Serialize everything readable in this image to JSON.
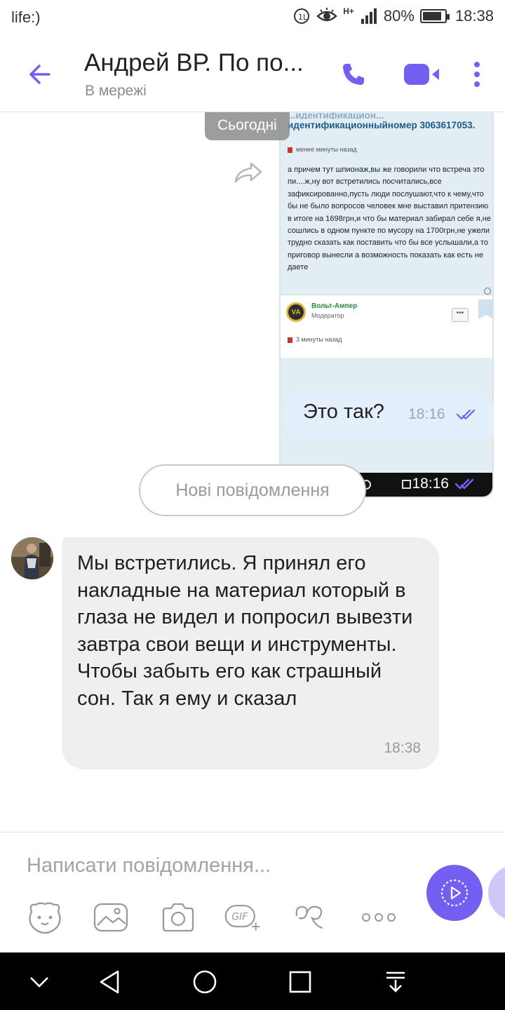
{
  "status_bar": {
    "carrier": "life:)",
    "battery_percent": "80%",
    "time": "18:38",
    "network": "H+",
    "icons": [
      "vowifi-icon",
      "eye-comfort-icon",
      "signal-icon",
      "battery-icon"
    ]
  },
  "header": {
    "contact_name": "Андрей ВР. По по...",
    "contact_status": "В мережі",
    "accent_color": "#7360f2",
    "icons": [
      "back-arrow-icon",
      "phone-icon",
      "video-call-icon",
      "more-vert-icon"
    ]
  },
  "chat": {
    "date_chip": "Сьогодні",
    "image_message": {
      "caption_title": "идентификационныйномер 3063617053.",
      "caption_top_faded": "...идентификацион...",
      "time_ago_1": "менее минуты назад",
      "body_text": "а причем тут шпионаж,вы же говорили что встреча это пи....ж,ну вот встретились посчитались,все зафиксированно,пусть люди послушают,что к чему,что бы не было вопросов человек мне выставил притензию в итоге на 1698грн,и что бы материал забирал себе я,не сошлись в одном пункте по мусору на 1700грн,не ужели трудно сказать как поставить что бы все услышали,а то приговор вынесли а возможность показать как есть не даете",
      "moderator_name": "Вольт-Ампер",
      "moderator_role": "Модератор",
      "avatar_letters": "VA",
      "menu_dots": "•••",
      "time_ago_2": "3 минуты назад",
      "time": "18:16"
    },
    "outgoing_message": {
      "text": "Это так?",
      "time": "18:16",
      "status": "read"
    },
    "new_messages_label": "Нові повідомлення",
    "incoming_message": {
      "text": "Мы встретились. Я принял его накладные на материал который в глаза не видел и попросил вывезти завтра свои вещи и инструменты. Чтобы забыть его как страшный сон. Так я ему и сказал",
      "time": "18:38"
    }
  },
  "composer": {
    "placeholder": "Написати повідомлення...",
    "tools": [
      "sticker-icon",
      "gallery-icon",
      "camera-icon",
      "gif-icon",
      "doodle-icon",
      "more-options-icon"
    ],
    "gif_label": "GIF"
  },
  "nav_bar": {
    "icons": [
      "collapse-icon",
      "back-triangle-icon",
      "home-circle-icon",
      "recents-square-icon",
      "notification-pull-icon"
    ]
  }
}
